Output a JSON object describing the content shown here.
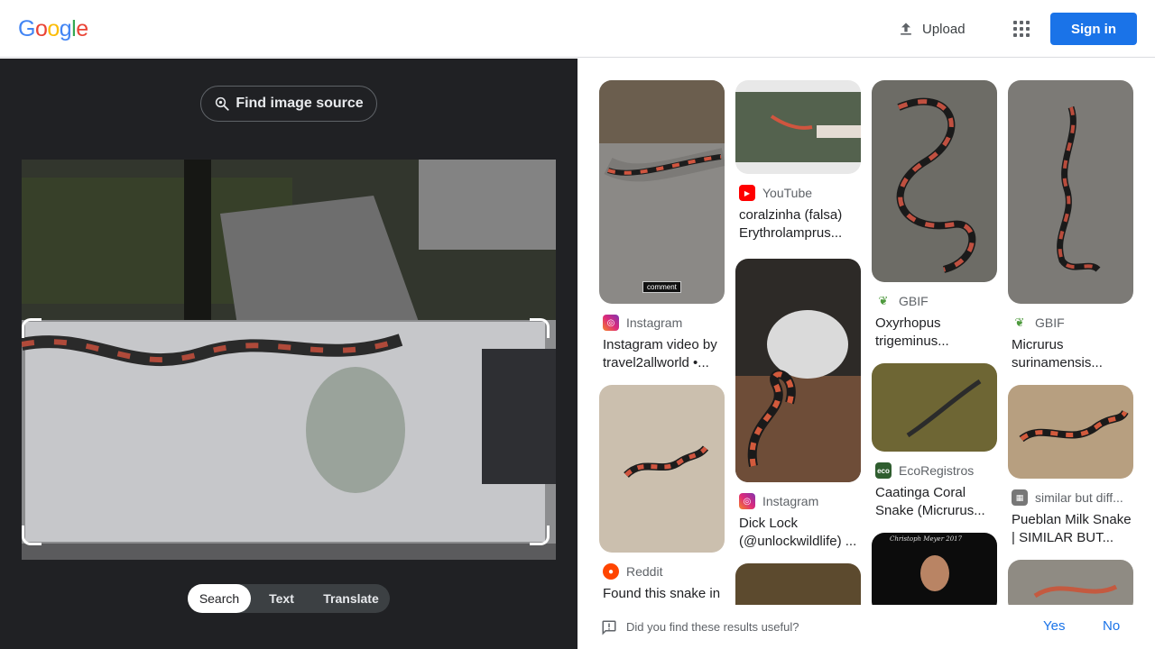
{
  "header": {
    "logo": [
      "G",
      "o",
      "o",
      "g",
      "l",
      "e"
    ],
    "logo_colors": [
      "#4285F4",
      "#EA4335",
      "#FBBC05",
      "#4285F4",
      "#34A853",
      "#EA4335"
    ],
    "upload_label": "Upload",
    "signin_label": "Sign in"
  },
  "left": {
    "find_source_label": "Find image source",
    "modes": [
      "Search",
      "Text",
      "Translate"
    ],
    "active_mode": "Search"
  },
  "results": [
    {
      "source": "Instagram",
      "icon": "instagram-icon",
      "title": "Instagram video by travel2allworld •...",
      "badge": "comment"
    },
    {
      "source": "Reddit",
      "icon": "reddit-icon",
      "title": "Found this snake in ..."
    },
    {
      "source": "YouTube",
      "icon": "youtube-icon",
      "title": "coralzinha (falsa) Erythrolamprus..."
    },
    {
      "source": "Instagram",
      "icon": "instagram-icon",
      "title": "Dick Lock (@unlockwildlife) ..."
    },
    {
      "source": "GBIF",
      "icon": "gbif-icon",
      "title": "Oxyrhopus trigeminus..."
    },
    {
      "source": "EcoRegistros",
      "icon": "ecoregistros-icon",
      "title": "Caatinga Coral Snake (Micrurus..."
    },
    {
      "overlay_text": "Christoph Meyer 2017"
    },
    {
      "source": "GBIF",
      "icon": "gbif-icon",
      "title": "Micrurus surinamensis..."
    },
    {
      "source": "similar but diff...",
      "icon": "site-icon",
      "title": "Pueblan Milk Snake | SIMILAR BUT..."
    }
  ],
  "feedback": {
    "question": "Did you find these results useful?",
    "yes": "Yes",
    "no": "No"
  },
  "colors": {
    "accent": "#1a73e8",
    "dark_panel": "#202124"
  }
}
